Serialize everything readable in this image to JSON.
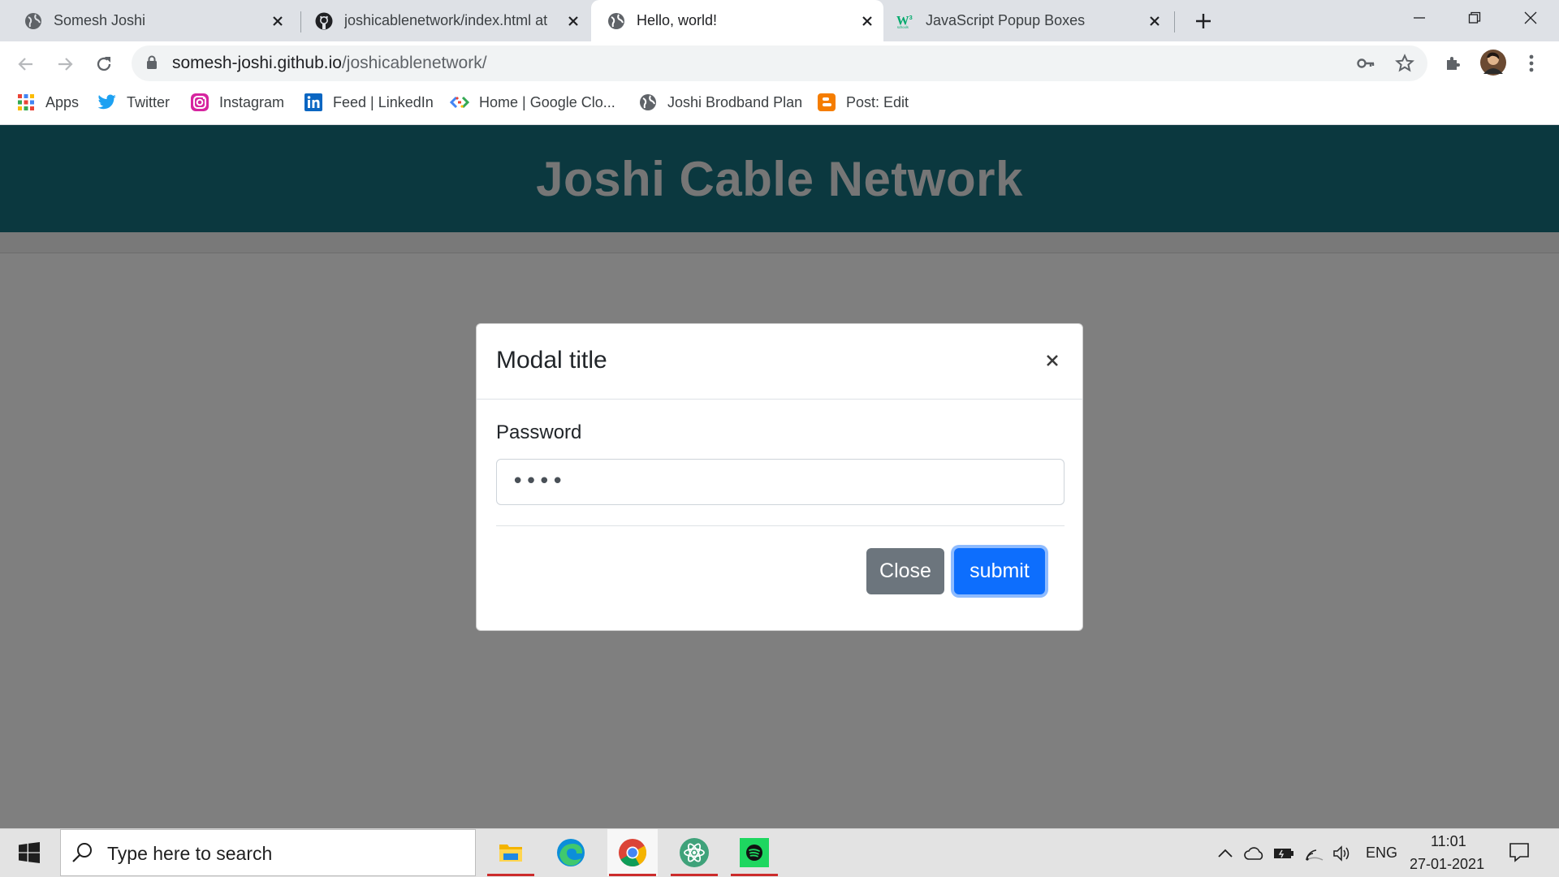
{
  "browser": {
    "tabs": [
      {
        "title": "Somesh Joshi",
        "icon": "globe-icon",
        "active": false
      },
      {
        "title": "joshicablenetwork/index.html at ",
        "icon": "github-icon",
        "active": false
      },
      {
        "title": "Hello, world!",
        "icon": "globe-icon",
        "active": true
      },
      {
        "title": "JavaScript Popup Boxes",
        "icon": "w3schools-icon",
        "active": false
      }
    ],
    "url_host": "somesh-joshi.github.io",
    "url_path": "/joshicablenetwork/",
    "bookmarks": [
      {
        "label": "Apps",
        "icon": "apps-grid-icon"
      },
      {
        "label": "Twitter",
        "icon": "twitter-icon"
      },
      {
        "label": "Instagram",
        "icon": "instagram-icon"
      },
      {
        "label": "Feed | LinkedIn",
        "icon": "linkedin-icon"
      },
      {
        "label": "Home | Google Clo...",
        "icon": "google-cloud-icon"
      },
      {
        "label": "Joshi Brodband Plan",
        "icon": "globe-icon"
      },
      {
        "label": "Post: Edit",
        "icon": "blogger-icon"
      }
    ]
  },
  "site": {
    "title": "Joshi Cable Network",
    "header_color": "#17707f"
  },
  "modal": {
    "title": "Modal title",
    "password_label": "Password",
    "password_value": "••••",
    "close_label": "Close",
    "submit_label": "submit"
  },
  "taskbar": {
    "search_placeholder": "Type here to search",
    "apps": [
      "file-explorer-icon",
      "edge-icon",
      "chrome-icon",
      "atom-icon",
      "spotify-icon"
    ],
    "language": "ENG",
    "time": "11:01",
    "date": "27-01-2021"
  },
  "colors": {
    "accent": "#0d6efd",
    "secondary": "#6c757d"
  }
}
